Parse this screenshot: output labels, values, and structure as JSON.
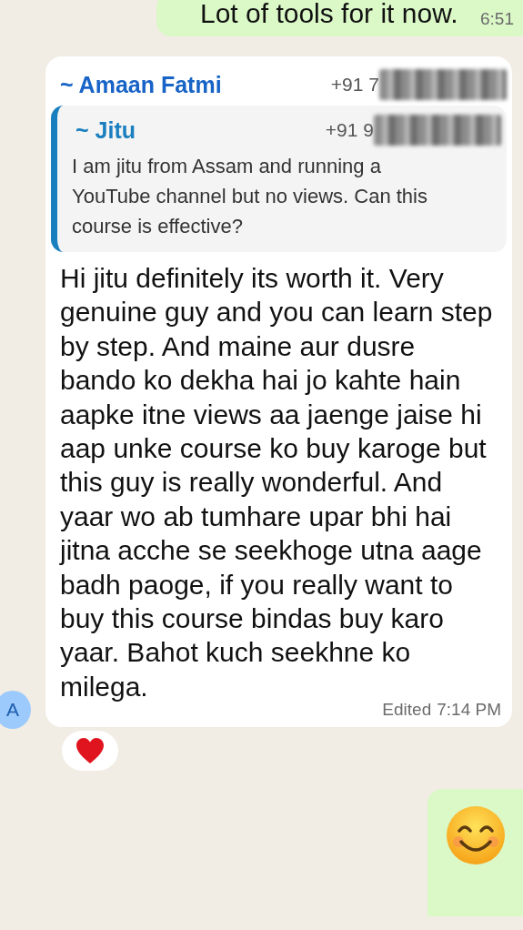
{
  "messages": [
    {
      "kind": "outgoing",
      "text": "Lot of tools for it now.",
      "time": "6:51"
    },
    {
      "kind": "incoming",
      "sender": "~ Amaan Fatmi",
      "phone": "+91 7",
      "avatar": "A",
      "quote": {
        "sender": "~ Jitu",
        "phone": "+91 9",
        "text": "I am jitu from Assam and running a YouTube channel but no views. Can this course is effective?"
      },
      "text": "Hi jitu definitely its worth it. Very genuine guy and you can learn step by step. And maine aur dusre bando ko dekha hai jo kahte hain aapke itne views aa jaenge jaise hi aap unke course ko buy karoge but this guy is really wonderful. And yaar wo ab tumhare upar bhi hai jitna acche se seekhoge utna aage badh paoge, if you really want to buy this course bindas buy karo yaar. Bahot kuch seekhne ko milega.",
      "edited": "Edited",
      "time": "7:14 PM",
      "reacted": true
    },
    {
      "kind": "emoji"
    }
  ]
}
